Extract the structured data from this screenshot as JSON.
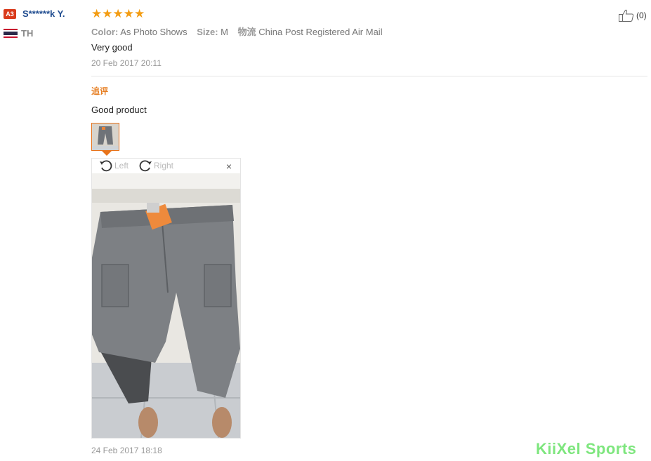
{
  "reviewer": {
    "level_badge": "A3",
    "name": "S******k Y.",
    "country_code": "TH",
    "flag_icon": "thailand-flag-icon"
  },
  "rating": {
    "stars": 5,
    "max": 5,
    "star_glyphs": "★★★★★",
    "color": "#f39c12"
  },
  "helpful": {
    "icon": "thumbs-up-icon",
    "count_label": "(0)"
  },
  "attributes": {
    "color_label": "Color:",
    "color_value": "As Photo Shows",
    "size_label": "Size:",
    "size_value": "M",
    "shipping_label": "物流",
    "shipping_value": "China Post Registered Air Mail"
  },
  "review": {
    "text": "Very good",
    "date": "20 Feb 2017 20:11"
  },
  "additional_review": {
    "heading": "追评",
    "text": "Good product",
    "date": "24 Feb 2017 18:18"
  },
  "image_viewer": {
    "rotate_left_label": "Left",
    "rotate_right_label": "Right",
    "close_glyph": "×",
    "image_icon": "review-photo-gray-cargo-pants"
  },
  "watermark": "KiiXel Sports",
  "colors": {
    "accent": "#e8731a",
    "username": "#1e4b8f",
    "badge": "#d93a1b"
  }
}
